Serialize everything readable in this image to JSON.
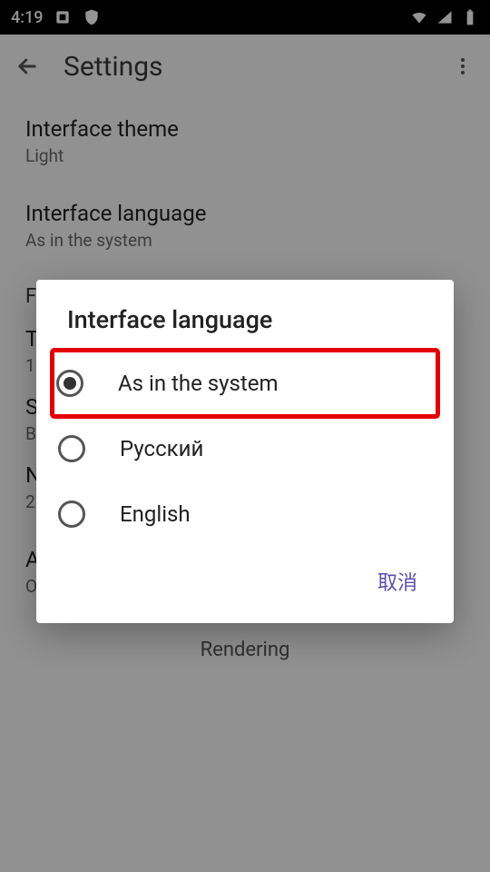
{
  "statusbar": {
    "time": "4:19"
  },
  "appbar": {
    "title": "Settings"
  },
  "settings": {
    "theme": {
      "label": "Interface theme",
      "value": "Light"
    },
    "language": {
      "label": "Interface language",
      "value": "As in the system"
    },
    "section_f_initial": "F",
    "item_t": {
      "label": "T",
      "value": "1"
    },
    "item_s": {
      "label": "S",
      "value": "B"
    },
    "item_n": {
      "label": "N",
      "value": "2"
    },
    "startup": {
      "label": "Action on startup",
      "value": "Open the last book"
    },
    "section_rendering": "Rendering"
  },
  "dialog": {
    "title": "Interface language",
    "options": {
      "o0": "As in the system",
      "o1": "Русский",
      "o2": "English"
    },
    "cancel": "取消"
  }
}
